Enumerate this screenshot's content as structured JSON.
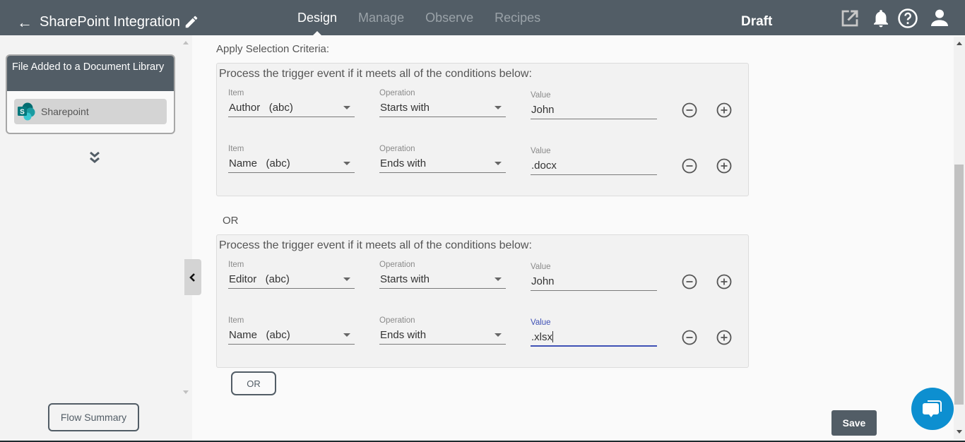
{
  "header": {
    "back_icon": "arrow-left-icon",
    "title": "SharePoint Integration",
    "edit_icon": "pencil-icon",
    "tabs": [
      {
        "label": "Design",
        "active": true
      },
      {
        "label": "Manage",
        "active": false
      },
      {
        "label": "Observe",
        "active": false
      },
      {
        "label": "Recipes",
        "active": false
      }
    ],
    "status": "Draft",
    "icons": [
      "external-link-icon",
      "bell-icon",
      "help-icon",
      "user-icon"
    ]
  },
  "sidebar": {
    "trigger_title": "File Added to a Document Library",
    "trigger_app": "Sharepoint",
    "expand_icon": "double-chevron-down-icon",
    "flow_summary_label": "Flow Summary",
    "collapse_icon": "chevron-left-icon"
  },
  "criteria": {
    "title": "Apply Selection Criteria:",
    "or_separator": "OR",
    "or_button_label": "OR",
    "groups": [
      {
        "description": "Process the trigger event if it meets all of the conditions below:",
        "conditions": [
          {
            "item_label": "Item",
            "item": "Author   (abc)",
            "operation_label": "Operation",
            "operation": "Starts with",
            "value_label": "Value",
            "value": "John"
          },
          {
            "item_label": "Item",
            "item": "Name   (abc)",
            "operation_label": "Operation",
            "operation": "Ends with",
            "value_label": "Value",
            "value": ".docx"
          }
        ]
      },
      {
        "description": "Process the trigger event if it meets all of the conditions below:",
        "conditions": [
          {
            "item_label": "Item",
            "item": "Editor   (abc)",
            "operation_label": "Operation",
            "operation": "Starts with",
            "value_label": "Value",
            "value": "John"
          },
          {
            "item_label": "Item",
            "item": "Name   (abc)",
            "operation_label": "Operation",
            "operation": "Ends with",
            "value_label": "Value",
            "value": ".xlsx",
            "focused": true
          }
        ]
      }
    ]
  },
  "footer": {
    "save_label": "Save",
    "chat_icon": "chat-bubble-icon"
  },
  "colors": {
    "header_bg": "#525d66",
    "focus_accent": "#3f51b5",
    "chat_bg": "#0d8fd0"
  }
}
